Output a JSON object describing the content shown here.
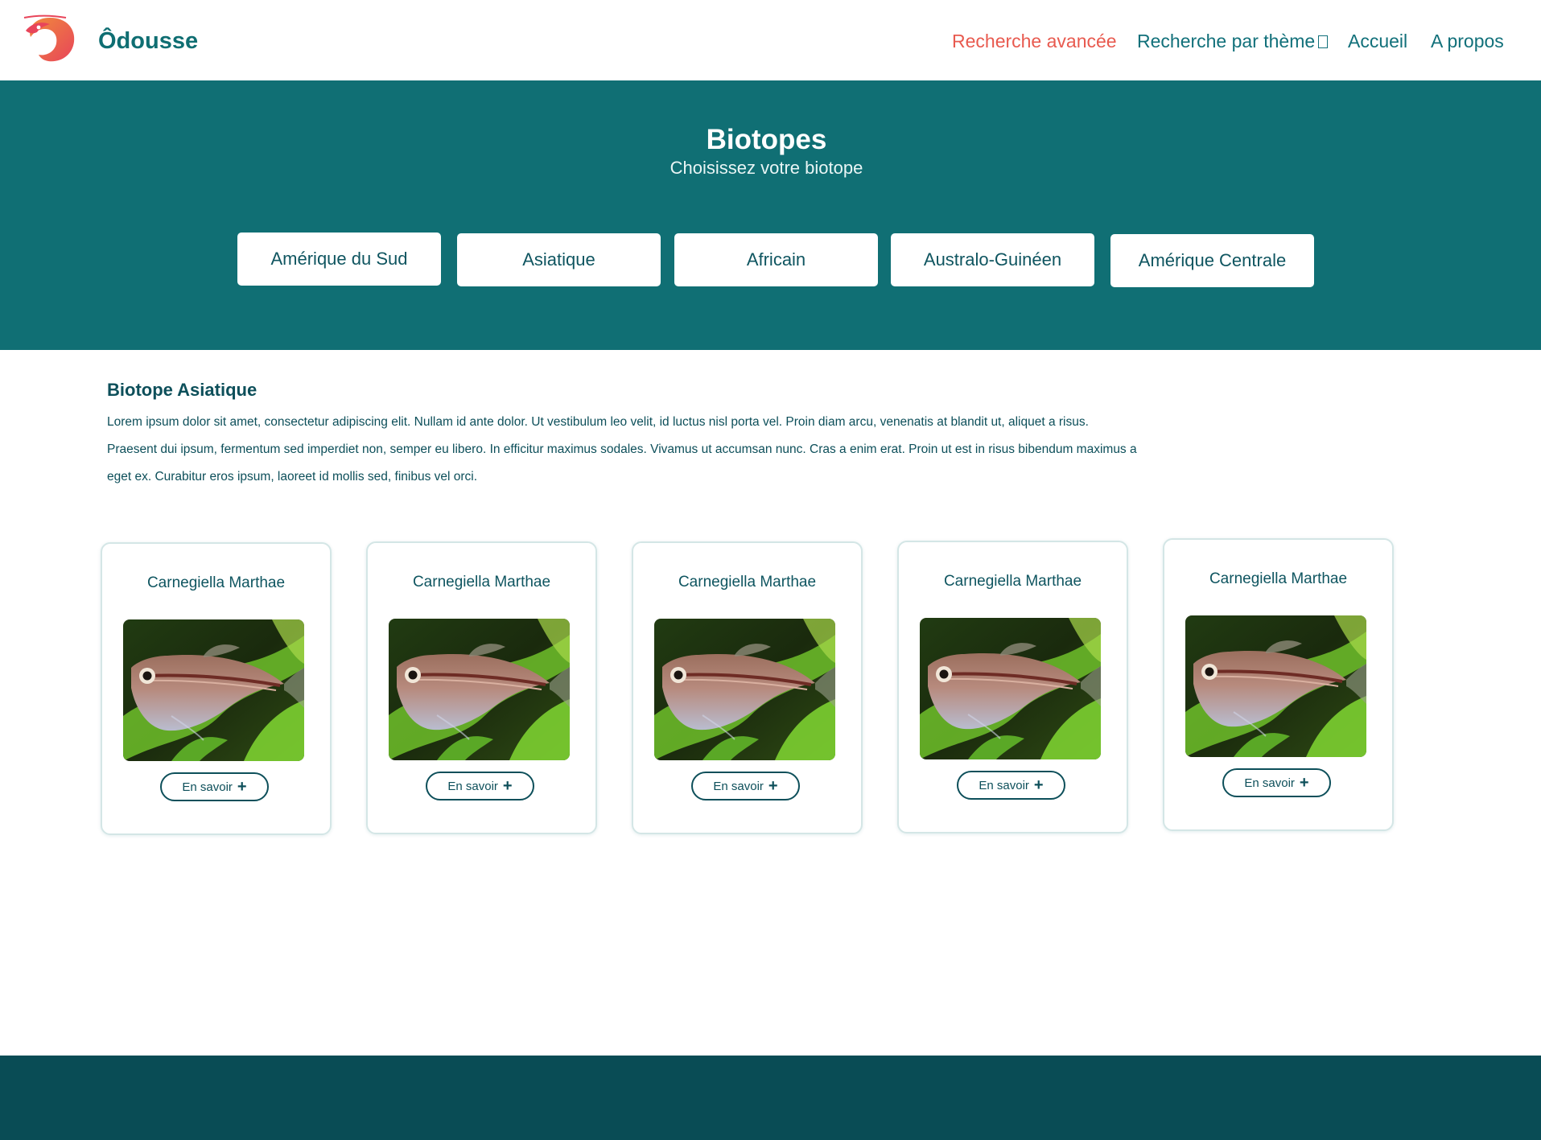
{
  "header": {
    "brand": "Ôdousse",
    "nav": {
      "advanced_search": "Recherche avancée",
      "theme_search": "Recherche par thème",
      "home": "Accueil",
      "about": "A propos"
    }
  },
  "hero": {
    "title": "Biotopes",
    "subtitle": "Choisissez votre biotope",
    "biotopes": [
      "Amérique du Sud",
      "Asiatique",
      "Africain",
      "Australo-Guinéen",
      "Amérique Centrale"
    ]
  },
  "section": {
    "title": "Biotope Asiatique",
    "text": "Lorem ipsum dolor sit amet, consectetur adipiscing elit. Nullam id ante dolor. Ut vestibulum leo velit, id luctus nisl porta vel. Proin diam arcu, venenatis at blandit ut, aliquet a risus. Praesent dui ipsum, fermentum sed imperdiet non, semper eu libero. In efficitur maximus sodales. Vivamus ut accumsan nunc. Cras a enim erat. Proin ut est in risus bibendum maximus a eget ex. Curabitur eros ipsum, laoreet id mollis sed, finibus vel orci."
  },
  "cards": [
    {
      "name": "Carnegiella Marthae",
      "button": "En savoir"
    },
    {
      "name": "Carnegiella Marthae",
      "button": "En savoir"
    },
    {
      "name": "Carnegiella Marthae",
      "button": "En savoir"
    },
    {
      "name": "Carnegiella Marthae",
      "button": "En savoir"
    },
    {
      "name": "Carnegiella Marthae",
      "button": "En savoir"
    }
  ],
  "colors": {
    "primary": "#106f74",
    "accent": "#e85a4f",
    "footer": "#094c55",
    "text": "#0d4f5a"
  }
}
